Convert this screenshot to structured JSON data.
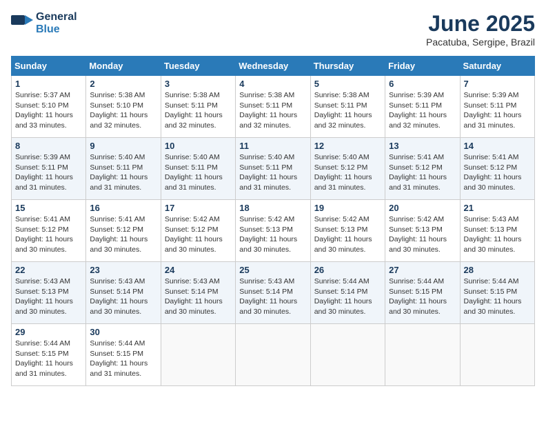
{
  "header": {
    "logo_line1": "General",
    "logo_line2": "Blue",
    "title": "June 2025",
    "subtitle": "Pacatuba, Sergipe, Brazil"
  },
  "weekdays": [
    "Sunday",
    "Monday",
    "Tuesday",
    "Wednesday",
    "Thursday",
    "Friday",
    "Saturday"
  ],
  "weeks": [
    [
      {
        "day": "1",
        "info": "Sunrise: 5:37 AM\nSunset: 5:10 PM\nDaylight: 11 hours\nand 33 minutes."
      },
      {
        "day": "2",
        "info": "Sunrise: 5:38 AM\nSunset: 5:10 PM\nDaylight: 11 hours\nand 32 minutes."
      },
      {
        "day": "3",
        "info": "Sunrise: 5:38 AM\nSunset: 5:11 PM\nDaylight: 11 hours\nand 32 minutes."
      },
      {
        "day": "4",
        "info": "Sunrise: 5:38 AM\nSunset: 5:11 PM\nDaylight: 11 hours\nand 32 minutes."
      },
      {
        "day": "5",
        "info": "Sunrise: 5:38 AM\nSunset: 5:11 PM\nDaylight: 11 hours\nand 32 minutes."
      },
      {
        "day": "6",
        "info": "Sunrise: 5:39 AM\nSunset: 5:11 PM\nDaylight: 11 hours\nand 32 minutes."
      },
      {
        "day": "7",
        "info": "Sunrise: 5:39 AM\nSunset: 5:11 PM\nDaylight: 11 hours\nand 31 minutes."
      }
    ],
    [
      {
        "day": "8",
        "info": "Sunrise: 5:39 AM\nSunset: 5:11 PM\nDaylight: 11 hours\nand 31 minutes."
      },
      {
        "day": "9",
        "info": "Sunrise: 5:40 AM\nSunset: 5:11 PM\nDaylight: 11 hours\nand 31 minutes."
      },
      {
        "day": "10",
        "info": "Sunrise: 5:40 AM\nSunset: 5:11 PM\nDaylight: 11 hours\nand 31 minutes."
      },
      {
        "day": "11",
        "info": "Sunrise: 5:40 AM\nSunset: 5:11 PM\nDaylight: 11 hours\nand 31 minutes."
      },
      {
        "day": "12",
        "info": "Sunrise: 5:40 AM\nSunset: 5:12 PM\nDaylight: 11 hours\nand 31 minutes."
      },
      {
        "day": "13",
        "info": "Sunrise: 5:41 AM\nSunset: 5:12 PM\nDaylight: 11 hours\nand 31 minutes."
      },
      {
        "day": "14",
        "info": "Sunrise: 5:41 AM\nSunset: 5:12 PM\nDaylight: 11 hours\nand 30 minutes."
      }
    ],
    [
      {
        "day": "15",
        "info": "Sunrise: 5:41 AM\nSunset: 5:12 PM\nDaylight: 11 hours\nand 30 minutes."
      },
      {
        "day": "16",
        "info": "Sunrise: 5:41 AM\nSunset: 5:12 PM\nDaylight: 11 hours\nand 30 minutes."
      },
      {
        "day": "17",
        "info": "Sunrise: 5:42 AM\nSunset: 5:12 PM\nDaylight: 11 hours\nand 30 minutes."
      },
      {
        "day": "18",
        "info": "Sunrise: 5:42 AM\nSunset: 5:13 PM\nDaylight: 11 hours\nand 30 minutes."
      },
      {
        "day": "19",
        "info": "Sunrise: 5:42 AM\nSunset: 5:13 PM\nDaylight: 11 hours\nand 30 minutes."
      },
      {
        "day": "20",
        "info": "Sunrise: 5:42 AM\nSunset: 5:13 PM\nDaylight: 11 hours\nand 30 minutes."
      },
      {
        "day": "21",
        "info": "Sunrise: 5:43 AM\nSunset: 5:13 PM\nDaylight: 11 hours\nand 30 minutes."
      }
    ],
    [
      {
        "day": "22",
        "info": "Sunrise: 5:43 AM\nSunset: 5:13 PM\nDaylight: 11 hours\nand 30 minutes."
      },
      {
        "day": "23",
        "info": "Sunrise: 5:43 AM\nSunset: 5:14 PM\nDaylight: 11 hours\nand 30 minutes."
      },
      {
        "day": "24",
        "info": "Sunrise: 5:43 AM\nSunset: 5:14 PM\nDaylight: 11 hours\nand 30 minutes."
      },
      {
        "day": "25",
        "info": "Sunrise: 5:43 AM\nSunset: 5:14 PM\nDaylight: 11 hours\nand 30 minutes."
      },
      {
        "day": "26",
        "info": "Sunrise: 5:44 AM\nSunset: 5:14 PM\nDaylight: 11 hours\nand 30 minutes."
      },
      {
        "day": "27",
        "info": "Sunrise: 5:44 AM\nSunset: 5:15 PM\nDaylight: 11 hours\nand 30 minutes."
      },
      {
        "day": "28",
        "info": "Sunrise: 5:44 AM\nSunset: 5:15 PM\nDaylight: 11 hours\nand 30 minutes."
      }
    ],
    [
      {
        "day": "29",
        "info": "Sunrise: 5:44 AM\nSunset: 5:15 PM\nDaylight: 11 hours\nand 31 minutes."
      },
      {
        "day": "30",
        "info": "Sunrise: 5:44 AM\nSunset: 5:15 PM\nDaylight: 11 hours\nand 31 minutes."
      },
      {
        "day": "",
        "info": ""
      },
      {
        "day": "",
        "info": ""
      },
      {
        "day": "",
        "info": ""
      },
      {
        "day": "",
        "info": ""
      },
      {
        "day": "",
        "info": ""
      }
    ]
  ]
}
